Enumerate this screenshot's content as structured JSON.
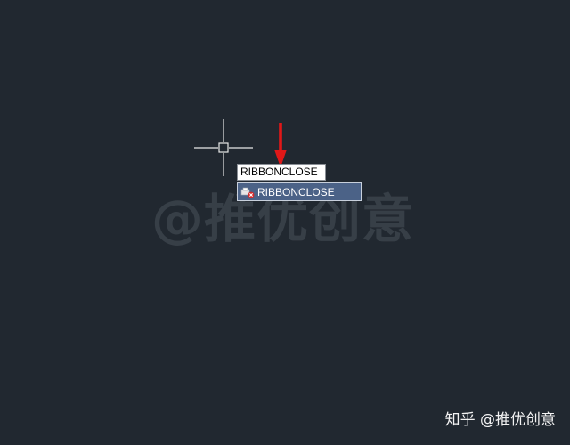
{
  "command_input": {
    "value": "RIBBONCLOSE"
  },
  "autocomplete": {
    "items": [
      {
        "label": "RIBBONCLOSE",
        "icon": "ribbon-close-icon"
      }
    ]
  },
  "watermark": {
    "center_text": "@推优创意",
    "footer_text": "知乎 @推优创意"
  },
  "colors": {
    "background": "#212830",
    "selection": "#4b6287",
    "arrow": "#e01818",
    "crosshair": "#e8e8e8"
  },
  "cursor": {
    "icon": "crosshair-cursor-icon"
  },
  "annotation": {
    "icon": "red-arrow-icon"
  }
}
